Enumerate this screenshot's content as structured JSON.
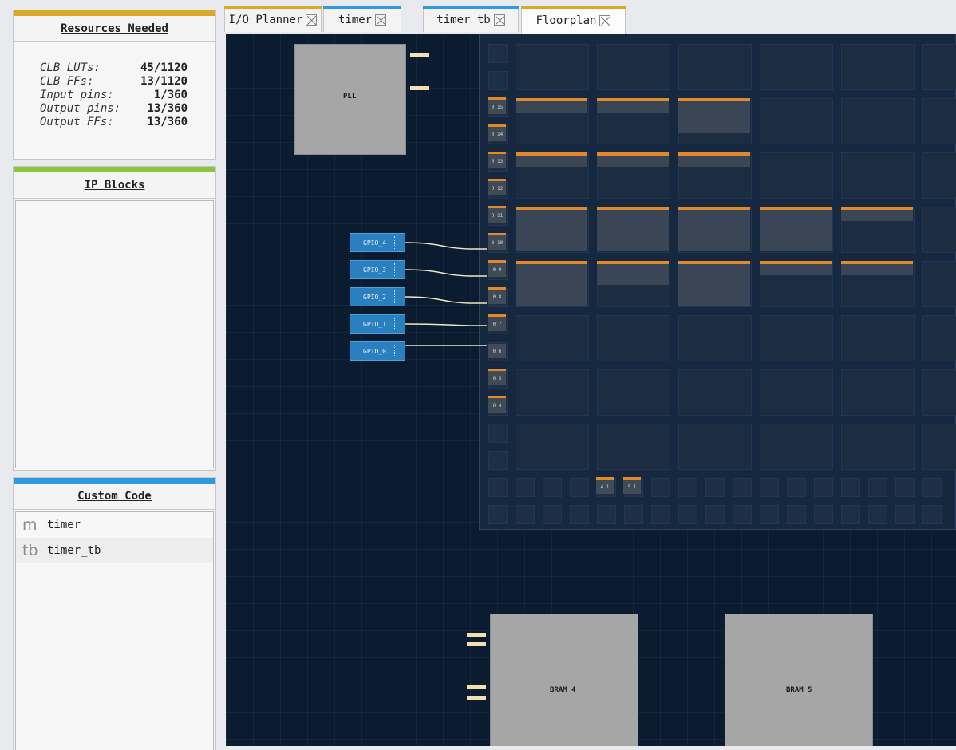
{
  "sidebar": {
    "resources": {
      "title": "Resources Needed",
      "accent": "#d8a926",
      "rows": [
        {
          "label": "CLB LUTs:",
          "value": "45/1120"
        },
        {
          "label": "CLB FFs:",
          "value": "13/1120"
        },
        {
          "label": "Input pins:",
          "value": "1/360"
        },
        {
          "label": "Output pins:",
          "value": "13/360"
        },
        {
          "label": "Output FFs:",
          "value": "13/360"
        }
      ]
    },
    "ip_blocks": {
      "title": "IP Blocks",
      "accent": "#8bc53f"
    },
    "custom_code": {
      "title": "Custom Code",
      "accent": "#2f9ae0",
      "items": [
        {
          "prefix": "m",
          "name": "timer"
        },
        {
          "prefix": "tb",
          "name": "timer_tb"
        }
      ]
    }
  },
  "tabs": [
    {
      "label": "I/O Planner",
      "accent": "#d8a926"
    },
    {
      "label": "timer",
      "accent": "#2f9ae0"
    },
    {
      "label": "timer_tb",
      "accent": "#2f9ae0"
    },
    {
      "label": "Floorplan",
      "accent": "#d8a926",
      "active": true
    }
  ],
  "floorplan": {
    "pll": {
      "title": "PLL"
    },
    "gpio": [
      "GPIO_4",
      "GPIO_3",
      "GPIO_2",
      "GPIO_1",
      "GPIO_0"
    ],
    "io_pins": [
      "0 15",
      "0 14",
      "0 13",
      "0 12",
      "0 11",
      "0 10",
      "0 9",
      "0 8",
      "0 7",
      "0 6",
      "0 5",
      "0 4"
    ],
    "bottom_pins": [
      "4 1",
      "5 1"
    ],
    "brams": [
      {
        "title": "BRAM_4"
      },
      {
        "title": "BRAM_5"
      }
    ],
    "colors": {
      "canvas": "#0b1b30",
      "used": "#e08a2c",
      "gpio": "#2a7fbf"
    }
  }
}
